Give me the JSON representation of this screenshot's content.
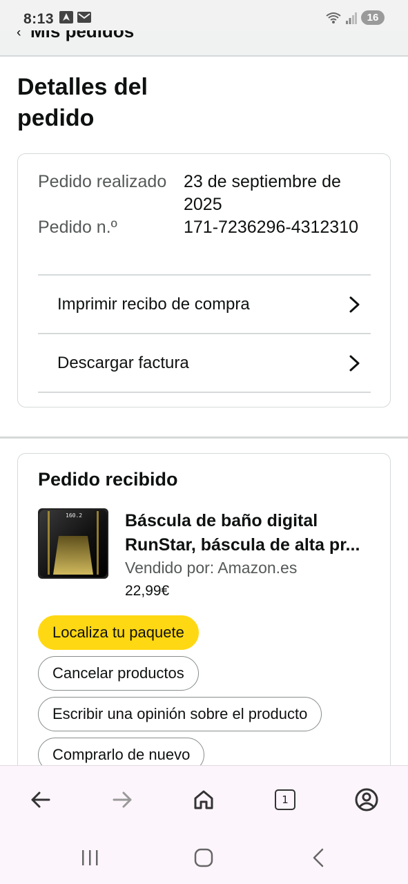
{
  "status_bar": {
    "time": "8:13",
    "battery": "16",
    "icons_left": [
      "navigation-arrow-icon",
      "mail-icon"
    ],
    "icons_right": [
      "wifi-icon",
      "signal-icon",
      "battery-icon"
    ]
  },
  "nav": {
    "back_label": "Mis pedidos"
  },
  "page": {
    "title": "Detalles del pedido"
  },
  "order_info": {
    "placed_label": "Pedido realizado",
    "placed_value": "23 de septiembre de 2025",
    "number_label": "Pedido n.º",
    "number_value": "171-7236296-4312310",
    "links": [
      {
        "label": "Imprimir recibo de compra"
      },
      {
        "label": "Descargar factura"
      }
    ]
  },
  "shipment": {
    "title": "Pedido recibido",
    "product": {
      "name": "Báscula de baño digital RunStar, báscula de alta pr...",
      "seller": "Vendido por: Amazon.es",
      "price": "22,99€",
      "image_display": "160.2"
    },
    "buttons": {
      "track": "Localiza tu paquete",
      "cancel": "Cancelar productos",
      "review": "Escribir una opinión sobre el producto",
      "buy_again": "Comprarlo de nuevo"
    }
  },
  "browser_bar": {
    "tab_count": "1"
  },
  "colors": {
    "primary_button": "#FFD814",
    "text": "#0F1111",
    "secondary_text": "#565959",
    "border": "#D5D9D9"
  }
}
